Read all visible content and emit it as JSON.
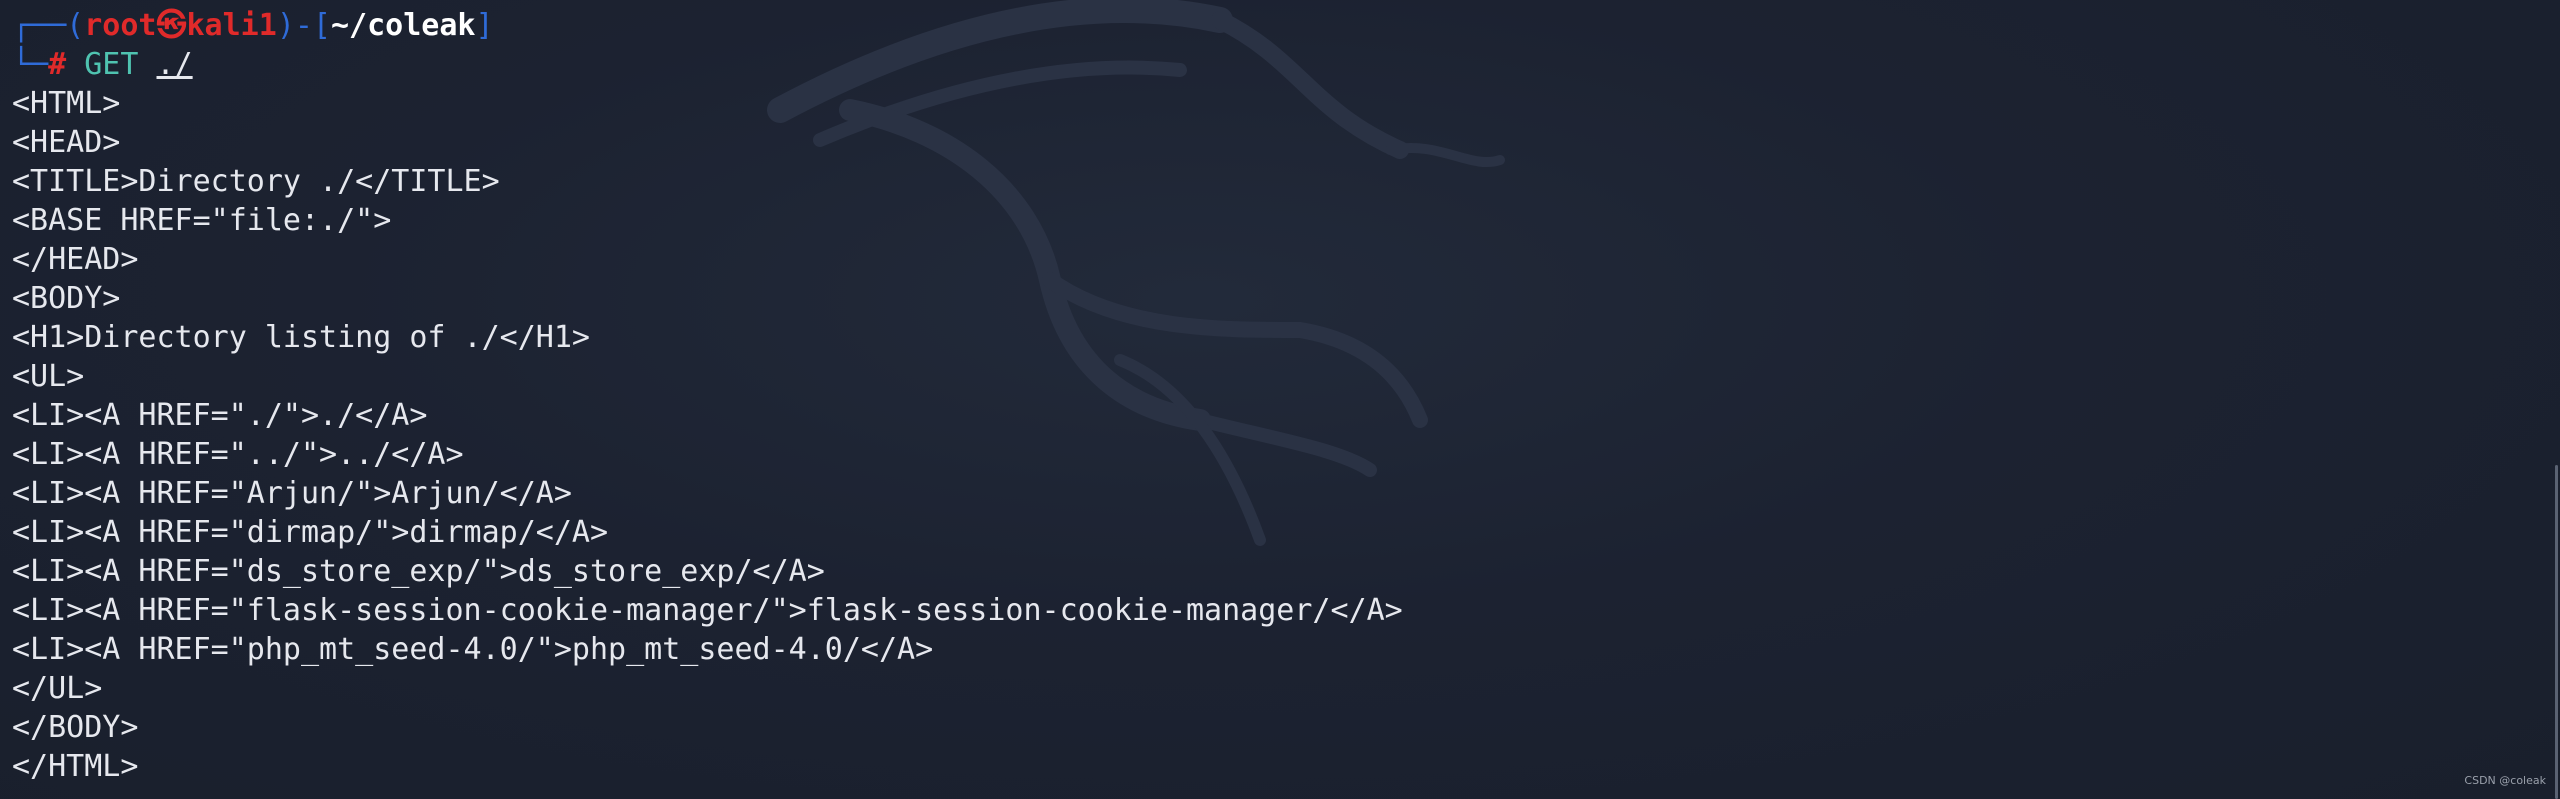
{
  "prompt": {
    "open_corner": "┌──(",
    "user": "root",
    "skull": "㉿",
    "host": "kali1",
    "mid": ")-[",
    "path": "~/coleak",
    "close": "]",
    "second_corner": "└─",
    "hash": "# ",
    "command": "GET",
    "argument": "./"
  },
  "output_lines": [
    "<HTML>",
    "<HEAD>",
    "<TITLE>Directory ./</TITLE>",
    "<BASE HREF=\"file:./\">",
    "</HEAD>",
    "<BODY>",
    "<H1>Directory listing of ./</H1>",
    "<UL>",
    "<LI><A HREF=\"./\">./</A>",
    "<LI><A HREF=\"../\">../</A>",
    "<LI><A HREF=\"Arjun/\">Arjun/</A>",
    "<LI><A HREF=\"dirmap/\">dirmap/</A>",
    "<LI><A HREF=\"ds_store_exp/\">ds_store_exp/</A>",
    "<LI><A HREF=\"flask-session-cookie-manager/\">flask-session-cookie-manager/</A>",
    "<LI><A HREF=\"php_mt_seed-4.0/\">php_mt_seed-4.0/</A>",
    "</UL>",
    "</BODY>",
    "</HTML>"
  ],
  "footer": {
    "credit": "CSDN @coleak"
  },
  "colors": {
    "background": "#1b2130",
    "prompt_corner": "#2f6bd8",
    "prompt_user": "#e02a2a",
    "command": "#4fc3b0",
    "text": "#e6e8ee"
  }
}
